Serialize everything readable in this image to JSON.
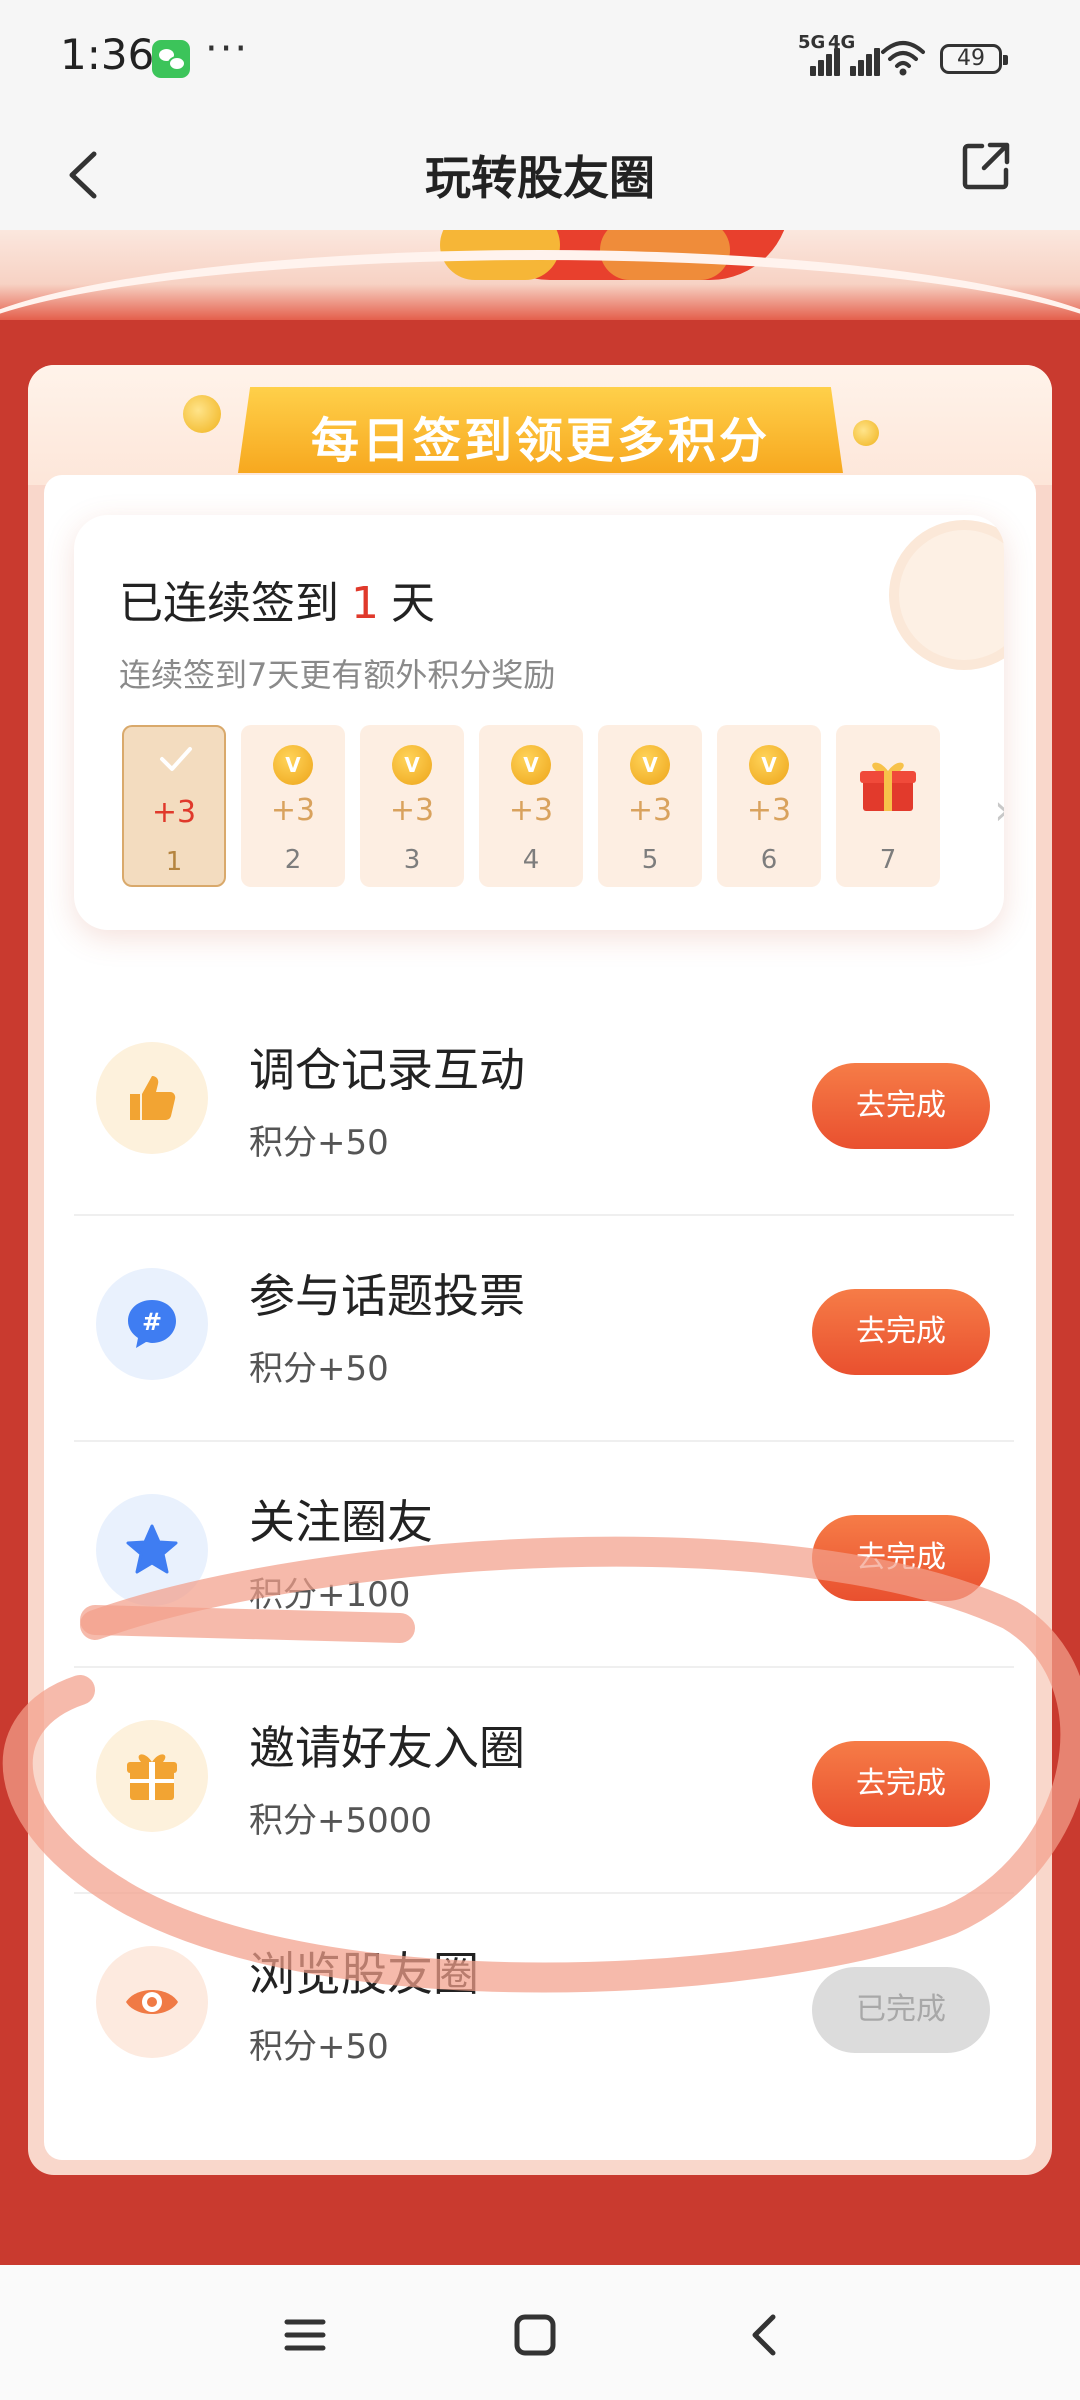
{
  "status_bar": {
    "time": "1:36",
    "network_1": "5G",
    "network_2": "4G",
    "battery": "49"
  },
  "header": {
    "title": "玩转股友圈"
  },
  "banner": {
    "text": "每日签到领更多积分"
  },
  "checkin": {
    "title_prefix": "已连续签到",
    "streak": "1",
    "title_suffix": "天",
    "subtitle": "连续签到7天更有额外积分奖励",
    "days": [
      {
        "points": "+3",
        "day": "1",
        "state": "done"
      },
      {
        "points": "+3",
        "day": "2",
        "state": "pending"
      },
      {
        "points": "+3",
        "day": "3",
        "state": "pending"
      },
      {
        "points": "+3",
        "day": "4",
        "state": "pending"
      },
      {
        "points": "+3",
        "day": "5",
        "state": "pending"
      },
      {
        "points": "+3",
        "day": "6",
        "state": "pending"
      },
      {
        "points": "",
        "day": "7",
        "state": "gift"
      }
    ]
  },
  "tasks": [
    {
      "name": "调仓记录互动",
      "points": "积分+50",
      "button": "去完成",
      "icon": "thumbs-up-icon",
      "state": "todo"
    },
    {
      "name": "参与话题投票",
      "points": "积分+50",
      "button": "去完成",
      "icon": "hashtag-chat-icon",
      "state": "todo"
    },
    {
      "name": "关注圈友",
      "points": "积分+100",
      "button": "去完成",
      "icon": "star-icon",
      "state": "todo"
    },
    {
      "name": "邀请好友入圈",
      "points": "积分+5000",
      "button": "去完成",
      "icon": "gift-icon",
      "state": "todo"
    },
    {
      "name": "浏览股友圈",
      "points": "积分+50",
      "button": "已完成",
      "icon": "eye-icon",
      "state": "done"
    }
  ],
  "colors": {
    "brand_red": "#c93a2f",
    "accent_orange": "#f0623a",
    "highlight_red": "#e0392b",
    "annotation_stroke": "#f2a08a"
  }
}
